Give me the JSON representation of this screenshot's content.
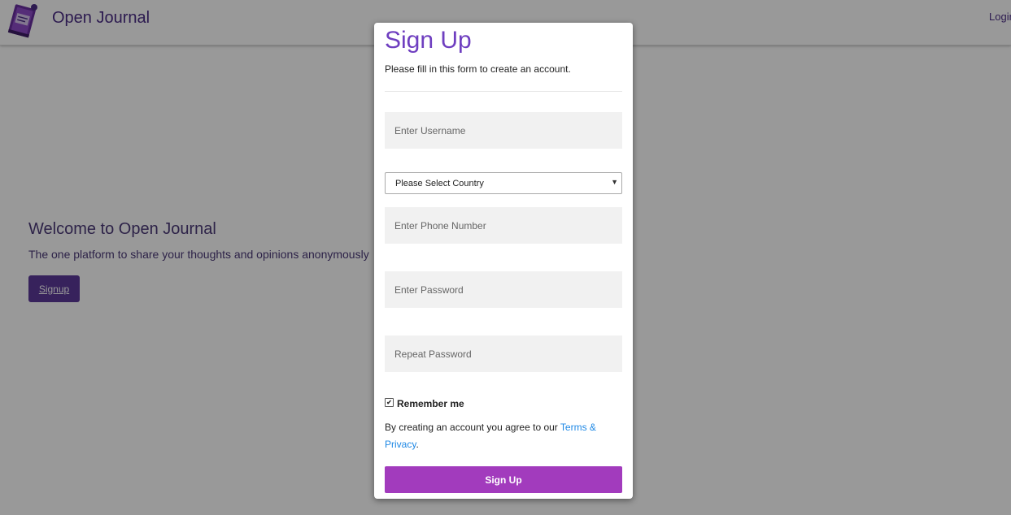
{
  "header": {
    "brand": "Open Journal",
    "logo_icon": "journal-book-icon",
    "login_label": "Login"
  },
  "hero": {
    "title": "Welcome to Open Journal",
    "subtitle": "The one platform to share your thoughts and opinions anonymously",
    "signup_label": "Signup"
  },
  "modal": {
    "title": "Sign Up",
    "subtitle": "Please fill in this form to create an account.",
    "username_placeholder": "Enter Username",
    "country_selected": "Please Select Country",
    "phone_placeholder": "Enter Phone Number",
    "password_placeholder": "Enter Password",
    "repeat_password_placeholder": "Repeat Password",
    "remember_label": "Remember me",
    "remember_checked": true,
    "terms_prefix": "By creating an account you agree to our ",
    "terms_link": "Terms & Privacy",
    "terms_suffix": ".",
    "submit_label": "Sign Up"
  },
  "colors": {
    "brand": "#4b2d86",
    "accent": "#a23bbd",
    "title": "#6f3fc0",
    "link": "#1e88e5"
  }
}
